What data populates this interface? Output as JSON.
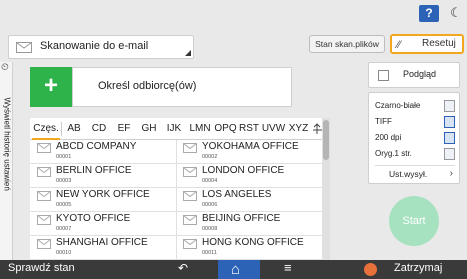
{
  "topbar": {
    "help_label": "?",
    "moon_icon": "moon-icon"
  },
  "header": {
    "destination_type": "Skanowanie do e-mail",
    "scan_status_button": "Stan skan.plików",
    "reset_button": "Resetuj"
  },
  "side_tab": {
    "label": "Wyświetl historię ustawień"
  },
  "add_destination": {
    "plus": "+",
    "label": "Określ odbiorcę(ów)"
  },
  "index_tabs": [
    "Częs.",
    "AB",
    "CD",
    "EF",
    "GH",
    "IJK",
    "LMN",
    "OPQ",
    "RST",
    "UVW",
    "XYZ"
  ],
  "active_tab": "Częs.",
  "entries": [
    {
      "name": "ABCD COMPANY",
      "num": "00001"
    },
    {
      "name": "YOKOHAMA OFFICE",
      "num": "00002"
    },
    {
      "name": "BERLIN OFFICE",
      "num": "00003"
    },
    {
      "name": "LONDON OFFICE",
      "num": "00004"
    },
    {
      "name": "NEW YORK OFFICE",
      "num": "00005"
    },
    {
      "name": "LOS ANGELES",
      "num": "00006"
    },
    {
      "name": "KYOTO OFFICE",
      "num": "00007"
    },
    {
      "name": "BEIJING OFFICE",
      "num": "00008"
    },
    {
      "name": "SHANGHAI  OFFICE",
      "num": "00010"
    },
    {
      "name": "HONG KONG OFFICE",
      "num": "00011"
    }
  ],
  "right_panel": {
    "preview": "Podgląd",
    "settings": [
      {
        "label": "Czarno-białe"
      },
      {
        "label": "TIFF"
      },
      {
        "label": "200 dpi"
      },
      {
        "label": "Oryg.1 str."
      }
    ],
    "send_settings": "Ust.wysył.",
    "start": "Start"
  },
  "bottom_bar": {
    "status": "Sprawdź stan",
    "stop": "Zatrzymaj"
  },
  "colors": {
    "accent_green": "#2db34a",
    "start_green": "#a6e2bf",
    "highlight_orange": "#f2a71d",
    "nav_blue": "#2d63b6"
  }
}
